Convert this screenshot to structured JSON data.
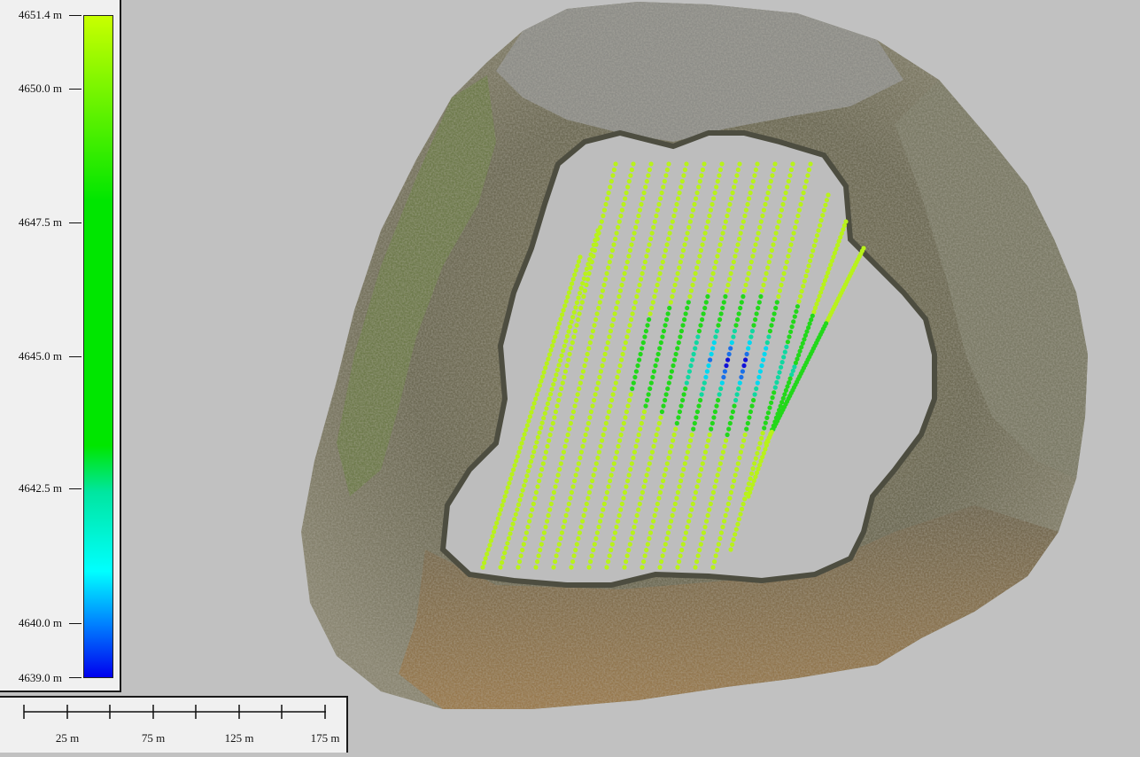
{
  "legend": {
    "top_label": "4651.4 m",
    "bottom_label": "4639.0 m",
    "ticks": [
      "4650.0 m",
      "4647.5 m",
      "4645.0 m",
      "4642.5 m",
      "4640.0 m"
    ],
    "colors": {
      "high": "#c8ff00",
      "mid_high": "#00e600",
      "mid": "#00ffff",
      "low": "#0000ee"
    }
  },
  "scale_bar": {
    "labels": [
      "25 m",
      "75 m",
      "125 m",
      "175 m"
    ]
  },
  "map": {
    "background_color": "#c1c1c1",
    "lake_color": "#bebebe"
  }
}
